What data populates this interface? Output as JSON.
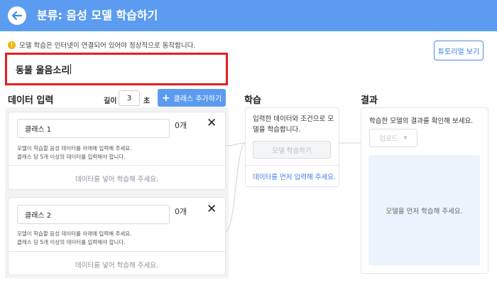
{
  "header": {
    "title": "분류: 음성 모델 학습하기"
  },
  "notice": {
    "text": "모델 학습은 인터넷이 연결되어 있어야 정상적으로 동작합니다.",
    "icon": "warning-icon"
  },
  "tutorial_button": {
    "label": "튜토리얼 보기"
  },
  "model_name": {
    "value": "동물 울음소리"
  },
  "data_input": {
    "title": "데이터 입력",
    "length_label": "길이",
    "length_value": "3",
    "length_unit": "초",
    "add_class_label": "클래스 추가하기"
  },
  "classes": [
    {
      "name": "클래스 1",
      "count": "0개",
      "note_line1": "모델이 학습할 음성 데이터를 아래에 입력해 주세요.",
      "note_line2": "클래스 당 5개 이상의 데이터를 입력해야 합니다.",
      "drop_text": "데이터를 넣어 학습해 주세요."
    },
    {
      "name": "클래스 2",
      "count": "0개",
      "note_line1": "모델이 학습할 음성 데이터를 아래에 입력해 주세요.",
      "note_line2": "클래스 당 5개 이상의 데이터를 입력해야 합니다.",
      "drop_text": "데이터를 넣어 학습해 주세요."
    }
  ],
  "learn": {
    "title": "학습",
    "desc_line1": "입력한 데이터와 조건으로 모",
    "desc_line2": "델을 학습합니다.",
    "button_label": "모델 학습하기",
    "link_text": "데이터를 먼저 입력해 주세요."
  },
  "result": {
    "title": "결과",
    "desc": "학습한 모델의 결과를 확인해 보세요.",
    "upload_label": "업로드",
    "placeholder": "모델을 먼저 학습해 주세요."
  },
  "colors": {
    "accent": "#5b9cf0",
    "highlight_border": "#e61e1e",
    "link": "#3b7de0"
  }
}
